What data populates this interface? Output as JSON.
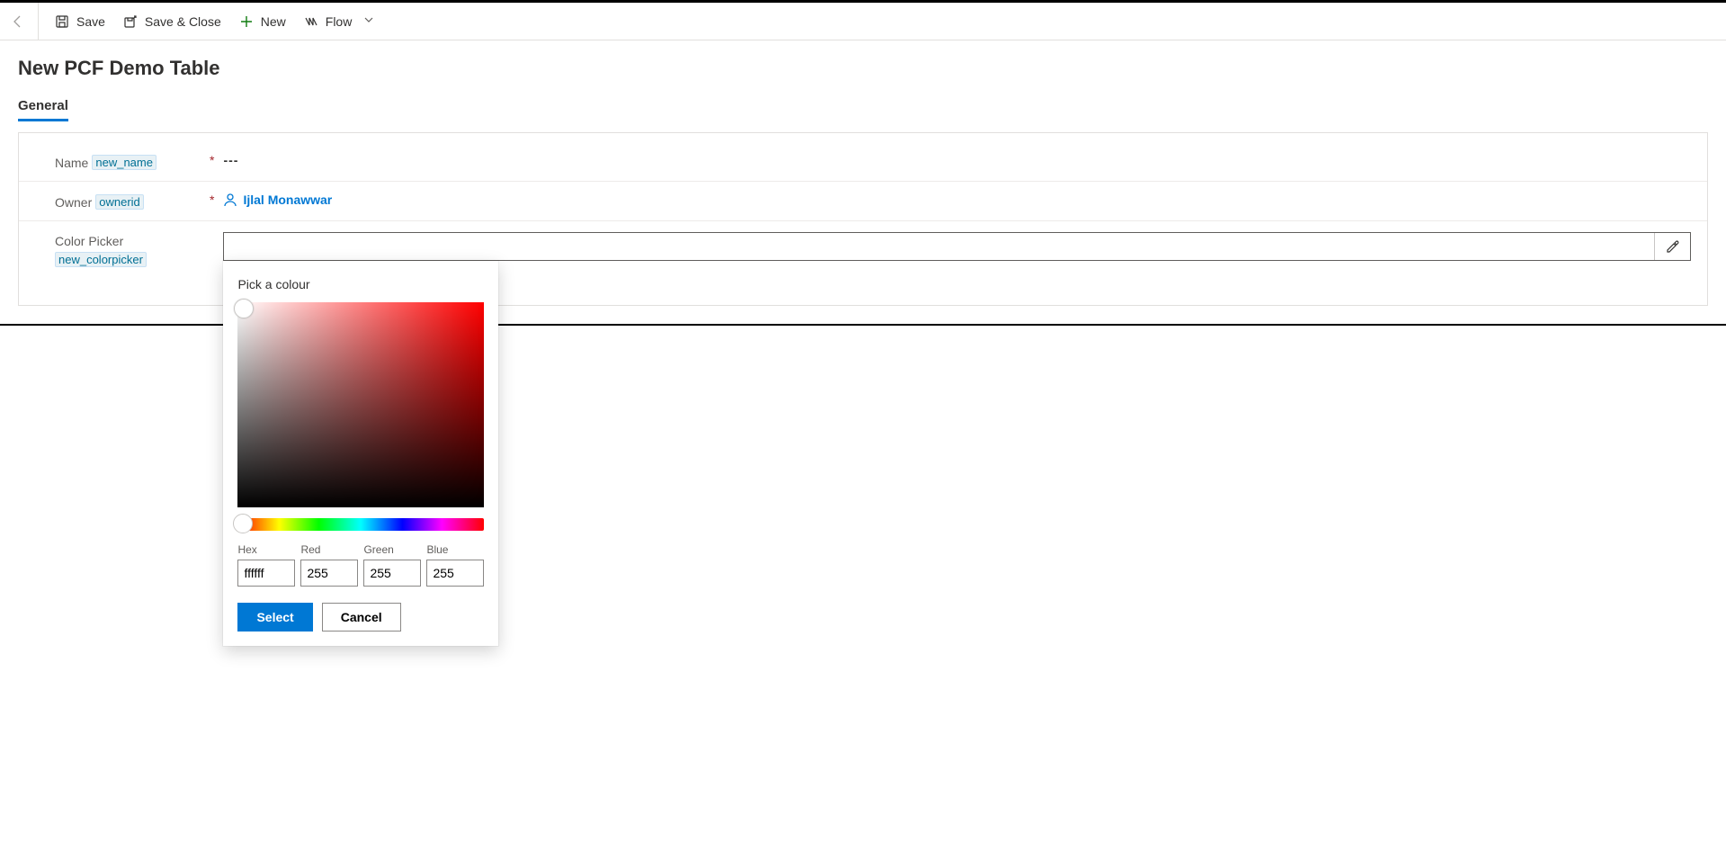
{
  "toolbar": {
    "save": "Save",
    "saveClose": "Save & Close",
    "new": "New",
    "flow": "Flow"
  },
  "page": {
    "title": "New PCF Demo Table"
  },
  "tabs": {
    "general": "General"
  },
  "fields": {
    "name": {
      "label": "Name",
      "schema": "new_name",
      "value": "---"
    },
    "owner": {
      "label": "Owner",
      "schema": "ownerid",
      "value": "Ijlal Monawwar"
    },
    "color": {
      "label": "Color Picker",
      "schema": "new_colorpicker",
      "value": ""
    }
  },
  "picker": {
    "title": "Pick a colour",
    "hexLabel": "Hex",
    "redLabel": "Red",
    "greenLabel": "Green",
    "blueLabel": "Blue",
    "hex": "ffffff",
    "red": "255",
    "green": "255",
    "blue": "255",
    "select": "Select",
    "cancel": "Cancel"
  }
}
